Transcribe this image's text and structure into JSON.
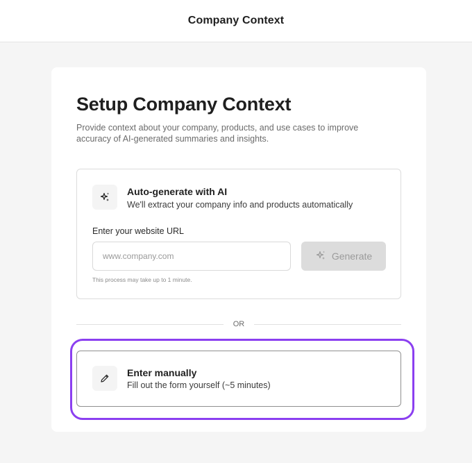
{
  "header": {
    "title": "Company Context"
  },
  "main": {
    "title": "Setup Company Context",
    "description": "Provide context about your company, products, and use cases to improve accuracy of AI-generated summaries and insights."
  },
  "ai_option": {
    "icon": "sparkles-icon",
    "title": "Auto-generate with AI",
    "subtitle": "We'll extract your company info and products automatically",
    "url_label": "Enter your website URL",
    "url_value": "",
    "url_placeholder": "www.company.com",
    "generate_label": "Generate",
    "note": "This process may take up to 1 minute."
  },
  "divider": {
    "label": "OR"
  },
  "manual_option": {
    "icon": "pencil-icon",
    "title": "Enter manually",
    "subtitle": "Fill out the form yourself (~5 minutes)"
  },
  "colors": {
    "highlight": "#8b3ff0",
    "button_disabled_bg": "#dcdcdc",
    "page_bg": "#f5f5f5"
  }
}
